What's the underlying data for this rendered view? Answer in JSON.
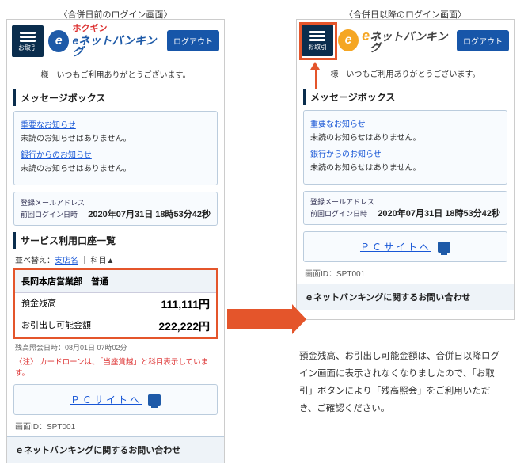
{
  "captions": {
    "before": "〈合併日前のログイン画面〉",
    "after": "〈合併日以降のログイン画面〉"
  },
  "header": {
    "menu_label": "お取引",
    "logo_small": "ホクギン",
    "logo_main_before": "eネットバンキング",
    "logo_main_after": "ネットバンキング",
    "logo_e": "e",
    "logout": "ログアウト"
  },
  "greeting": "様　いつもご利用ありがとうございます。",
  "msgbox": {
    "title": "メッセージボックス",
    "n1_link": "重要なお知らせ",
    "n1_text": "未読のお知らせはありません。",
    "n2_link": "銀行からのお知らせ",
    "n2_text": "未読のお知らせはありません。"
  },
  "meta": {
    "label_mail": "登録メールアドレス",
    "label_last": "前回ログイン日時",
    "timestamp": "2020年07月31日 18時53分42秒"
  },
  "accounts": {
    "title": "サービス利用口座一覧",
    "sort_prefix": "並べ替え：",
    "sort_link": "支店名",
    "sort_sep": " ｜ 科目▲",
    "head": "長岡本店営業部　普通",
    "row1_label": "預金残高",
    "row1_value": "111,111円",
    "row2_label": "お引出し可能金額",
    "row2_value": "222,222円",
    "asof": "残高照会日時：08月01日 07時02分",
    "note_tag": "〈注〉",
    "note_body": "カードローンは、「当座貸越」と科目表示しています。"
  },
  "pcsite": "ＰＣサイトへ",
  "screen_id_label": "画面ID：",
  "screen_id": "SPT001",
  "footer": "ｅネットバンキングに関するお問い合わせ",
  "explain": "預金残高、お引出し可能金額は、合併日以降ログイン画面に表示されなくなりましたので、「お取引」ボタンにより「残高照会」をご利用いただき、ご確認ください。"
}
